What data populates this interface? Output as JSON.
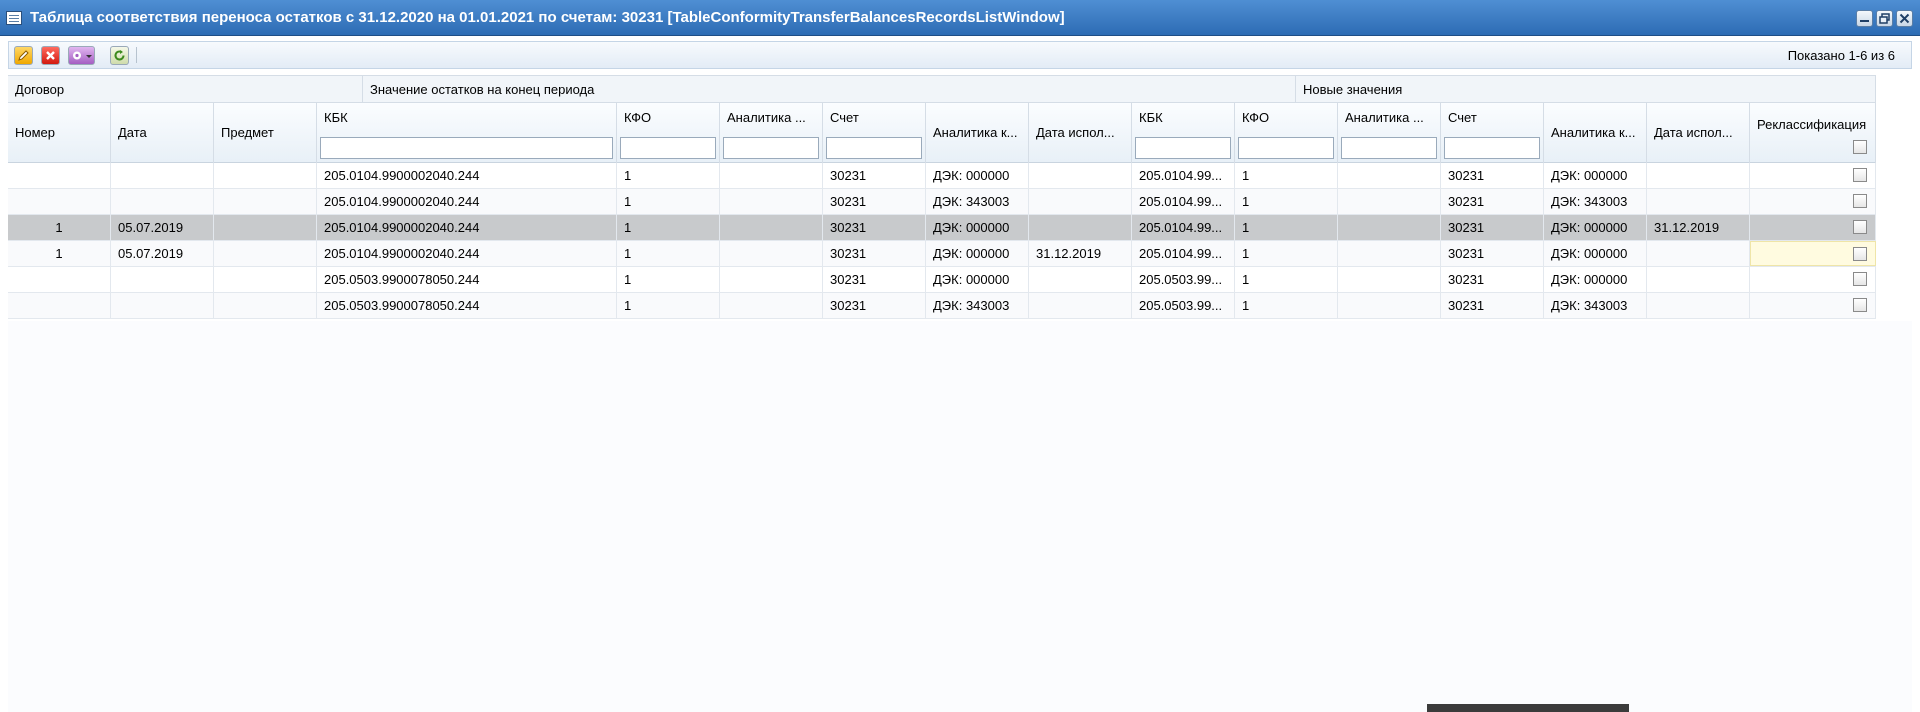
{
  "window": {
    "title": "Таблица соответствия переноса остатков с 31.12.2020 на 01.01.2021 по счетам: 30231 [TableConformityTransferBalancesRecordsListWindow]",
    "icon": "table-window-icon",
    "controls": [
      "minimize-icon",
      "restore-icon",
      "close-icon"
    ]
  },
  "toolbar": {
    "buttons": [
      {
        "name": "edit-button",
        "icon": "pencil-icon"
      },
      {
        "name": "delete-button",
        "icon": "red-x-icon"
      },
      {
        "name": "actions-dropdown-button",
        "icon": "gear-icon"
      },
      {
        "name": "refresh-button",
        "icon": "refresh-icon"
      }
    ],
    "shown_text": "Показано 1-6 из 6"
  },
  "grid": {
    "groups": [
      "Договор",
      "Значение остатков на конец периода",
      "Новые значения"
    ],
    "columns": [
      "Номер",
      "Дата",
      "Предмет",
      "КБК",
      "КФО",
      "Аналитика ...",
      "Счет",
      "Аналитика к...",
      "Дата испол...",
      "КБК",
      "КФО",
      "Аналитика ...",
      "Счет",
      "Аналитика к...",
      "Дата испол...",
      "Реклассификация"
    ],
    "rows": [
      [
        "",
        "",
        "",
        "205.0104.9900002040.244",
        "1",
        "",
        "30231",
        "ДЭК: 000000",
        "",
        "205.0104.99...",
        "1",
        "",
        "30231",
        "ДЭК: 000000",
        "",
        ""
      ],
      [
        "",
        "",
        "",
        "205.0104.9900002040.244",
        "1",
        "",
        "30231",
        "ДЭК: 343003",
        "",
        "205.0104.99...",
        "1",
        "",
        "30231",
        "ДЭК: 343003",
        "",
        ""
      ],
      [
        "1",
        "05.07.2019",
        "",
        "205.0104.9900002040.244",
        "1",
        "",
        "30231",
        "ДЭК: 000000",
        "",
        "205.0104.99...",
        "1",
        "",
        "30231",
        "ДЭК: 000000",
        "31.12.2019",
        ""
      ],
      [
        "1",
        "05.07.2019",
        "",
        "205.0104.9900002040.244",
        "1",
        "",
        "30231",
        "ДЭК: 000000",
        "31.12.2019",
        "205.0104.99...",
        "1",
        "",
        "30231",
        "ДЭК: 000000",
        "",
        ""
      ],
      [
        "",
        "",
        "",
        "205.0503.9900078050.244",
        "1",
        "",
        "30231",
        "ДЭК: 000000",
        "",
        "205.0503.99...",
        "1",
        "",
        "30231",
        "ДЭК: 000000",
        "",
        ""
      ],
      [
        "",
        "",
        "",
        "205.0503.9900078050.244",
        "1",
        "",
        "30231",
        "ДЭК: 343003",
        "",
        "205.0503.99...",
        "1",
        "",
        "30231",
        "ДЭК: 343003",
        "",
        ""
      ]
    ],
    "selected_row": 3,
    "editing_cell": {
      "row": 4,
      "column": 15
    },
    "reclassification_checked": [
      false,
      false,
      false,
      false,
      false,
      false
    ]
  },
  "colors": {
    "title_bar": "#3b7bc4",
    "selected_row": "#c8cacc",
    "editing_cell": "#fffbe0"
  }
}
